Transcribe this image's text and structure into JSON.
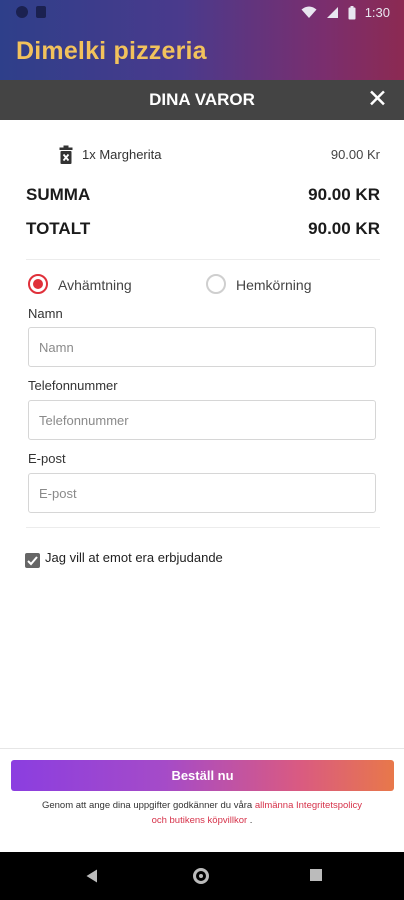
{
  "status_bar": {
    "time": "1:30"
  },
  "app": {
    "title": "Dimelki pizzeria"
  },
  "cart": {
    "title": "DINA VAROR",
    "items": [
      {
        "label": "1x Margherita",
        "price": "90.00 Kr"
      }
    ],
    "summa_label": "SUMMA",
    "summa_value": "90.00 KR",
    "totalt_label": "TOTALT",
    "totalt_value": "90.00 KR"
  },
  "delivery": {
    "pickup_label": "Avhämtning",
    "delivery_label": "Hemkörning",
    "selected": "pickup"
  },
  "form": {
    "name": {
      "label": "Namn",
      "placeholder": "Namn",
      "value": ""
    },
    "phone": {
      "label": "Telefonnummer",
      "placeholder": "Telefonnummer",
      "value": ""
    },
    "email": {
      "label": "E-post",
      "placeholder": "E-post",
      "value": ""
    }
  },
  "offers": {
    "label": "Jag vill at emot era erbjudande",
    "checked": true
  },
  "order": {
    "button_label": "Beställ nu",
    "terms_prefix": "Genom att ange dina uppgifter godkänner du våra",
    "terms_link1": "allmänna Integritetspolicy",
    "terms_link2": "och butikens köpvillkor",
    "terms_suffix": "."
  },
  "colors": {
    "accent": "#e0303a",
    "title_text": "#f2c25c",
    "cart_header": "#444444"
  },
  "icons": [
    "trash-icon",
    "close-icon",
    "wifi-icon",
    "signal-icon",
    "battery-icon",
    "check-icon",
    "back-icon",
    "home-icon",
    "recent-apps-icon"
  ]
}
